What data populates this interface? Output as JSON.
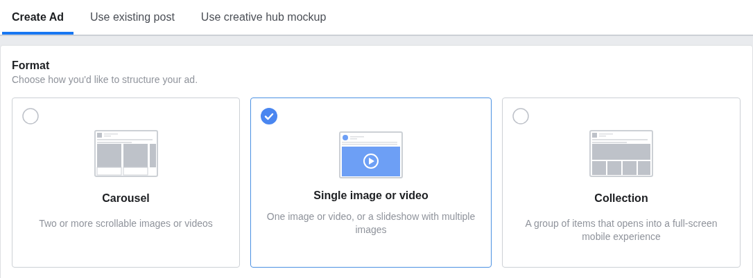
{
  "tabs": [
    {
      "label": "Create Ad",
      "selected": true
    },
    {
      "label": "Use existing post",
      "selected": false
    },
    {
      "label": "Use creative hub mockup",
      "selected": false
    }
  ],
  "format": {
    "title": "Format",
    "subtitle": "Choose how you'd like to structure your ad.",
    "options": [
      {
        "kind": "carousel",
        "title": "Carousel",
        "description": "Two or more scrollable images or videos",
        "selected": false
      },
      {
        "kind": "single",
        "title": "Single image or video",
        "description": "One image or video, or a slideshow with multiple images",
        "selected": true
      },
      {
        "kind": "collection",
        "title": "Collection",
        "description": "A group of items that opens into a full-screen mobile experience",
        "selected": false
      }
    ]
  }
}
